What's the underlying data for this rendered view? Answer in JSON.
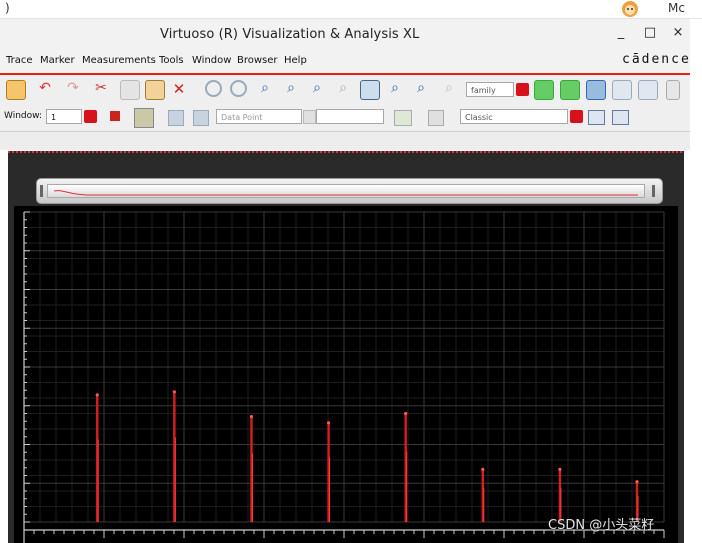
{
  "os": {
    "left_text": ")",
    "right_text": "Mc"
  },
  "window": {
    "title": "Virtuoso (R) Visualization & Analysis XL",
    "buttons": {
      "minimize": "_",
      "maximize": "□",
      "close": "×"
    }
  },
  "menu": {
    "items": [
      "Trace",
      "Marker",
      "Measurements",
      "Tools",
      "Window",
      "Browser",
      "Help"
    ],
    "brand": "cādence"
  },
  "toolbar": {
    "family_field": "family",
    "window_label": "Window:",
    "window_value": "1",
    "data_point_field": "Data Point",
    "style_field": "Classic"
  },
  "colors": {
    "accent": "#e2211c",
    "plot_background": "#000000",
    "grid": "#3a3a3a",
    "trace": "#d81e1e"
  },
  "watermark": "CSDN @小头菜籽",
  "chart_data": {
    "type": "bar",
    "series": [
      {
        "values": [
          0.41,
          0.42,
          0.34,
          0.32,
          0.35,
          0.17,
          0.17,
          0.13
        ]
      }
    ],
    "x": [
      1,
      2,
      3,
      4,
      5,
      6,
      7,
      8
    ],
    "grid": true
  }
}
